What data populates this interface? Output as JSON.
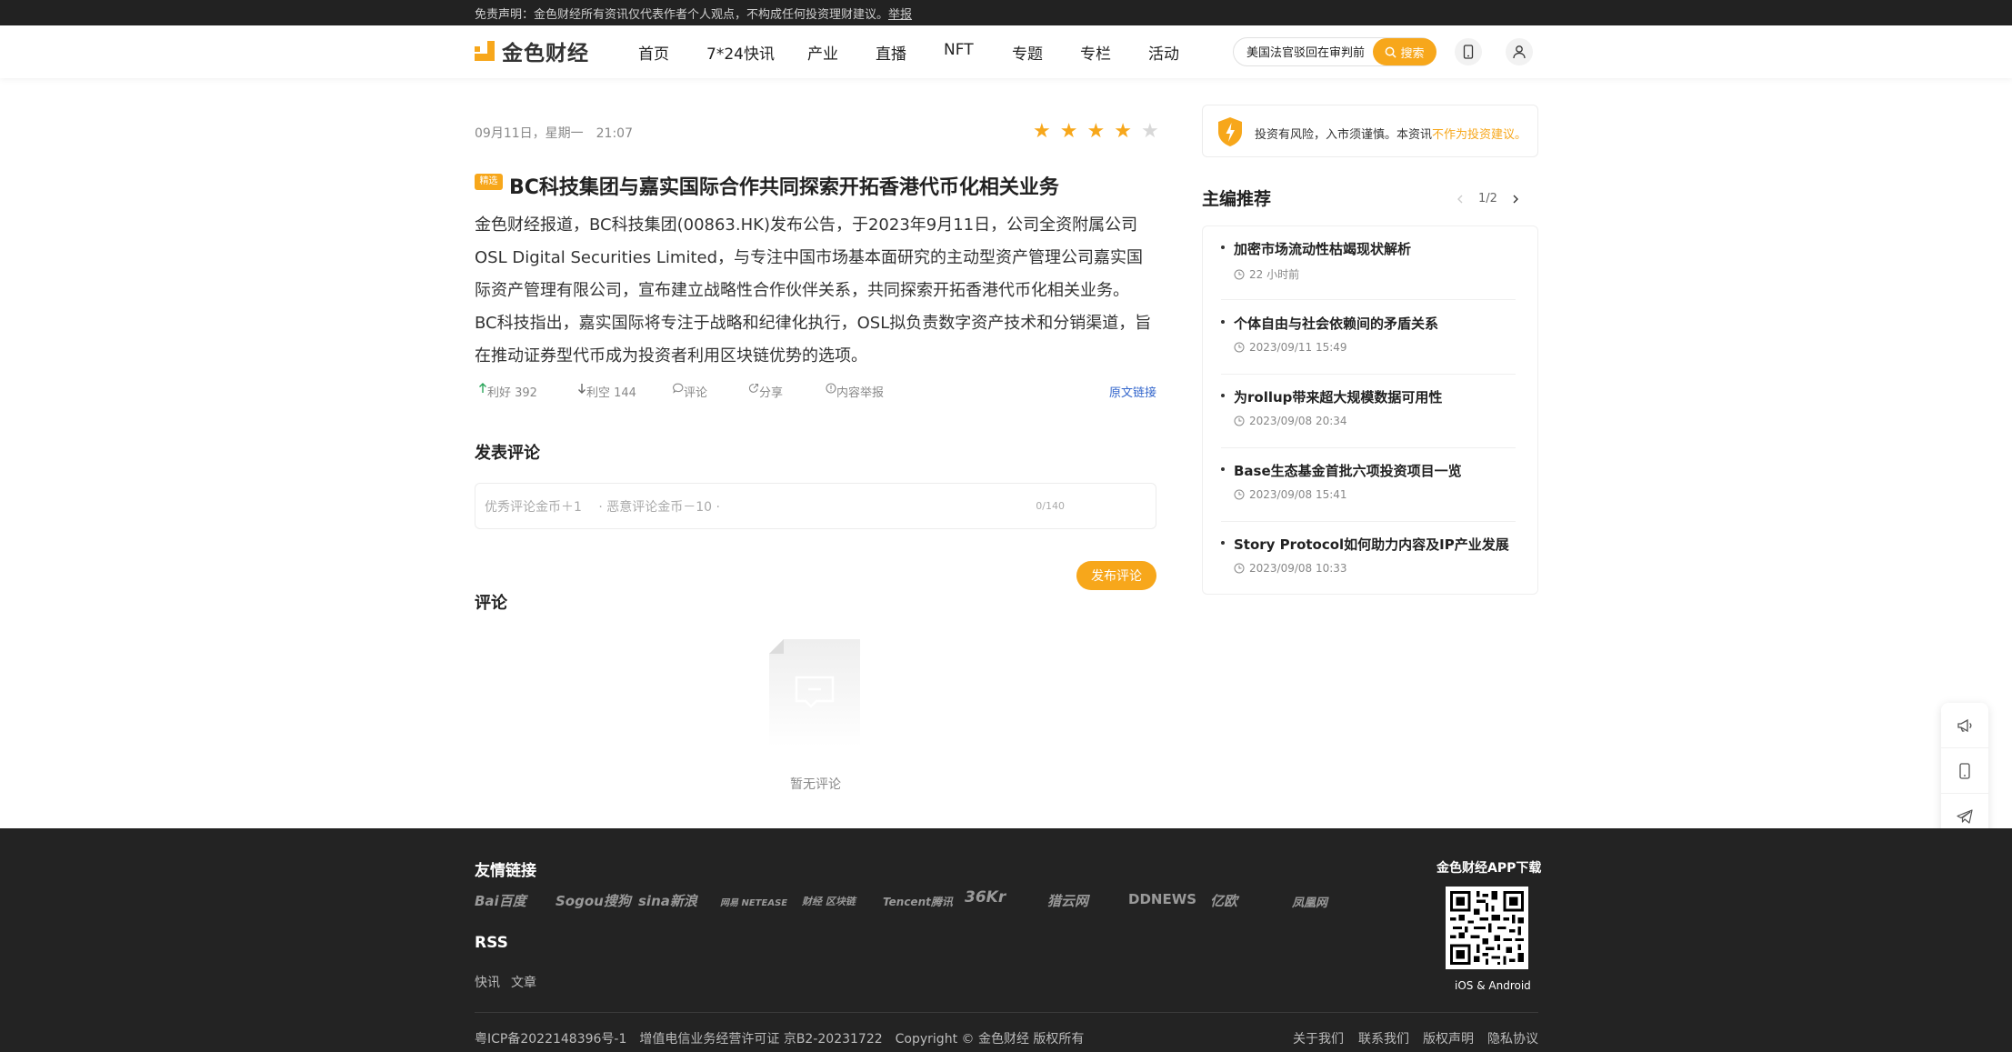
{
  "topbar": {
    "disclaimer": "免责声明：金色财经所有资讯仅代表作者个人观点，不构成任何投资理财建议。",
    "report": "举报"
  },
  "header": {
    "logo_text": "金色财经",
    "nav": [
      "首页",
      "7*24快讯",
      "产业",
      "直播",
      "NFT",
      "专题",
      "专栏",
      "活动"
    ],
    "search_value": "美国法官驳回在审判前…",
    "search_button": "搜索"
  },
  "article": {
    "date": "09月11日，星期一　21:07",
    "rating": 4,
    "badge": "精选",
    "title": "BC科技集团与嘉实国际合作共同探索开拓香港代币化相关业务",
    "para1": "金色财经报道，BC科技集团(00863.HK)发布公告，于2023年9月11日，公司全资附属公司OSL Digital Securities Limited，与专注中国市场基本面研究的主动型资产管理公司嘉实国际资产管理有限公司，宣布建立战略性合作伙伴关系，共同探索开拓香港代币化相关业务。",
    "para2": "BC科技指出，嘉实国际将专注于战略和纪律化执行，OSL拟负责数字资产技术和分销渠道，旨在推动证券型代币成为投资者利用区块链优势的选项。",
    "bull": "利好 392",
    "bear": "利空 144",
    "comment": "评论",
    "share": "分享",
    "report": "内容举报",
    "source_link": "原文链接"
  },
  "comment_form": {
    "heading": "发表评论",
    "placeholder": "优秀评论金币＋1　 · 恶意评论金币－10 ·",
    "counter": "0/140",
    "publish": "发布评论"
  },
  "comments": {
    "heading": "评论",
    "empty": "暂无评论"
  },
  "sidebar": {
    "risk_text": "投资有风险，入市须谨慎。本资讯",
    "risk_highlight": "不作为投资建议。",
    "rec_title": "主编推荐",
    "pager": "1/2",
    "items": [
      {
        "title": "加密市场流动性枯竭现状解析",
        "time": "22 小时前"
      },
      {
        "title": "个体自由与社会依赖间的矛盾关系",
        "time": "2023/09/11 15:49"
      },
      {
        "title": "为rollup带来超大规模数据可用性",
        "time": "2023/09/08 20:34"
      },
      {
        "title": "Base生态基金首批六项投资项目一览",
        "time": "2023/09/08 15:41"
      },
      {
        "title": "Story Protocol如何助力内容及IP产业发展",
        "time": "2023/09/08 10:33"
      }
    ]
  },
  "footer": {
    "links_heading": "友情链接",
    "partners": [
      "Bai百度",
      "Sogou搜狗",
      "sina新浪",
      "网易 NETEASE",
      "财经 区块链",
      "Tencent腾讯",
      "36Kr",
      "猎云网",
      "DDNEWS",
      "亿欧",
      "凤凰网"
    ],
    "rss_heading": "RSS",
    "rss_links": [
      "快讯",
      "文章"
    ],
    "app_heading": "金色财经APP下载",
    "app_platforms": "iOS & Android",
    "copyright": "粤ICP备2022148396号-1　增值电信业务经营许可证 京B2-20231722　Copyright © 金色财经 版权所有",
    "bottom_links": [
      "关于我们",
      "联系我们",
      "版权声明",
      "隐私协议"
    ]
  },
  "colors": {
    "accent": "#F7A71B",
    "link": "#3366CC",
    "footer_bg": "#232323",
    "topbar_bg": "#222222"
  },
  "icons": [
    "search-icon",
    "mobile-icon",
    "user-icon",
    "star-icon",
    "arrow-up-icon",
    "arrow-down-icon",
    "comment-icon",
    "share-icon",
    "info-icon",
    "shield-icon",
    "clock-icon",
    "megaphone-icon",
    "telegram-icon",
    "feedback-icon",
    "chevron-up-icon",
    "chevron-down-icon",
    "qrcode-icon"
  ]
}
